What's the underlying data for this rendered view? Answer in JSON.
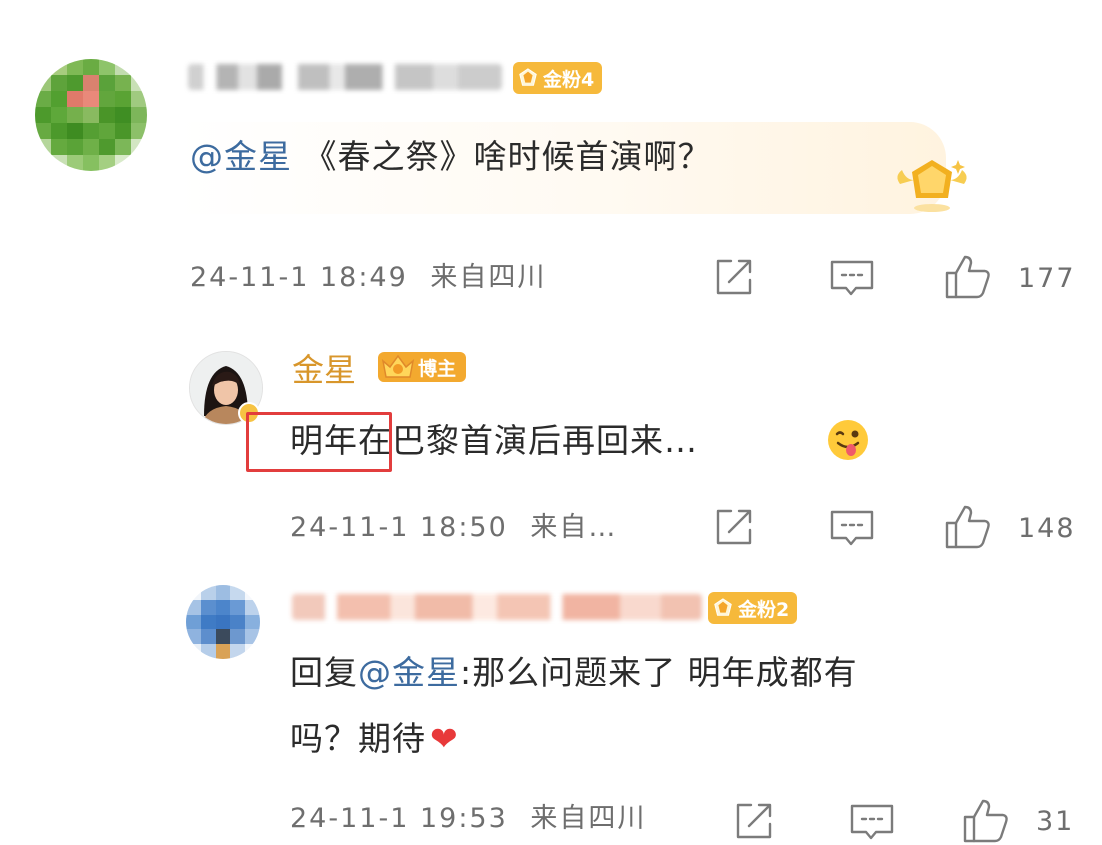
{
  "comments": [
    {
      "badge": "金粉4",
      "mention": "@金星",
      "text": " 《春之祭》啥时候首演啊？",
      "time": "24-11-1 18:49",
      "location": "来自四川",
      "likes": "177"
    },
    {
      "author": "金星",
      "host_badge": "博主",
      "text_boxed": "明年",
      "text_rest": "在巴黎首演后再回来…",
      "emoji": "😜",
      "time": "24-11-1 18:50",
      "location": "来自…",
      "likes": "148"
    },
    {
      "badge": "金粉2",
      "reply_prefix": "回复",
      "mention": "@金星",
      "line1_rest": ":那么问题来了 明年成都有",
      "line2": "吗？期待",
      "heart": "❤",
      "time": "24-11-1 19:53",
      "location": "来自四川",
      "likes": "31"
    }
  ],
  "icons": {
    "share": "share-icon",
    "comment": "comment-icon",
    "like": "like-icon",
    "badge_gem": "gem-icon",
    "crown": "crown-icon"
  },
  "colors": {
    "mention": "#3d6b9f",
    "badge": "#f6b93b",
    "author_name": "#d8962b",
    "highlight_box": "#e23d3d"
  }
}
